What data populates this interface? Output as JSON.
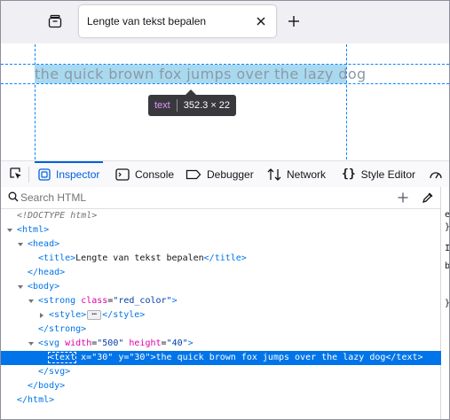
{
  "browser": {
    "tab_title": "Lengte van tekst bepalen"
  },
  "page": {
    "sample_text": "the quick brown fox jumps over the lazy dog",
    "tooltip_tag": "text",
    "tooltip_size": "352.3 × 22"
  },
  "devtools": {
    "tabs": [
      "Inspector",
      "Console",
      "Debugger",
      "Network",
      "Style Editor"
    ],
    "search_placeholder": "Search HTML"
  },
  "tree": {
    "doctype": "<!DOCTYPE html>",
    "html_open": "<html>",
    "head_open": "<head>",
    "title_open": "<title>",
    "title_text": "Lengte van tekst bepalen",
    "title_close": "</title>",
    "head_close": "</head>",
    "body_open": "<body>",
    "strong_open": "<strong",
    "strong_attr": "class",
    "strong_val": "\"red_color\"",
    "strong_end": ">",
    "style_open": "<style>",
    "style_close": "</style>",
    "strong_close": "</strong>",
    "svg_open": "<svg",
    "svg_attr1": "width",
    "svg_val1": "\"500\"",
    "svg_attr2": "height",
    "svg_val2": "\"40\"",
    "svg_end": ">",
    "text_open": "<text",
    "text_attr1": "x",
    "text_val1": "\"30\"",
    "text_attr2": "y",
    "text_val2": "\"30\"",
    "text_content": ">the quick brown fox jumps over the lazy dog</text>",
    "svg_close": "</svg>",
    "body_close": "</body>",
    "html_close": "</html>"
  },
  "right_pane": {
    "lines": [
      "e",
      "}",
      "",
      "I",
      "",
      "b",
      "",
      "}"
    ]
  }
}
